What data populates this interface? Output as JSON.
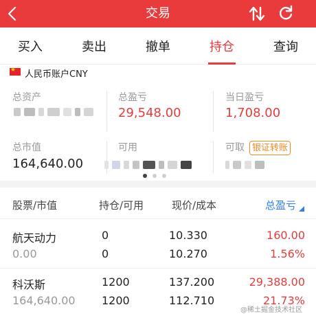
{
  "header": {
    "title": "交易"
  },
  "tabs": [
    {
      "label": "买入"
    },
    {
      "label": "卖出"
    },
    {
      "label": "撤单"
    },
    {
      "label": "持仓"
    },
    {
      "label": "查询"
    }
  ],
  "active_tab": "持仓",
  "account": {
    "label": "人民币账户CNY"
  },
  "summary": {
    "total_assets_label": "总资产",
    "total_pnl_label": "总盈亏",
    "total_pnl_value": "29,548.00",
    "today_pnl_label": "当日盈亏",
    "today_pnl_value": "1,708.00",
    "market_value_label": "总市值",
    "market_value_value": "164,640.00",
    "available_label": "可用",
    "withdrawable_label": "可取",
    "bank_transfer_label": "银证转账"
  },
  "table": {
    "headers": {
      "stock": "股票/市值",
      "position": "持仓/可用",
      "price": "现价/成本",
      "pnl": "总盈亏"
    },
    "rows": [
      {
        "name": "航天动力",
        "market_value": "0.00",
        "position": "0",
        "available": "0",
        "price": "10.330",
        "cost": "10.270",
        "pnl": "160.00",
        "pnl_pct": "1.56%"
      },
      {
        "name": "科沃斯",
        "market_value": "164,640.00",
        "position": "1200",
        "available": "1200",
        "price": "137.200",
        "cost": "112.710",
        "pnl": "29,388.00",
        "pnl_pct": "21.73%"
      }
    ]
  },
  "watermark": "@稀土掘金技术社区",
  "colors": {
    "brand_red": "#e93b3b",
    "sort_blue": "#2d7ff0",
    "orange": "#f08a24"
  }
}
